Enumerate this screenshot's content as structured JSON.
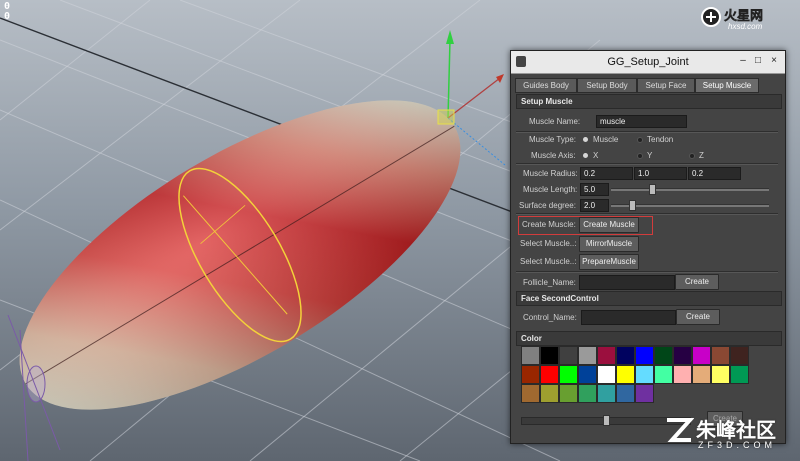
{
  "hud": {
    "line1": "0",
    "line2": "0"
  },
  "watermarks": {
    "top_right_domain": "hxsd.com",
    "bottom_right_cn": "朱峰社区",
    "bottom_right_url": "ZF3D.COM"
  },
  "window": {
    "title": "GG_Setup_Joint",
    "tabs": [
      "Guides Body",
      "Setup Body",
      "Setup Face",
      "Setup Muscle"
    ],
    "active_tab": "Setup Muscle",
    "setup_muscle": {
      "header": "Setup Muscle",
      "muscle_name_label": "Muscle Name:",
      "muscle_name_value": "muscle",
      "muscle_type_label": "Muscle Type:",
      "muscle_type_options": [
        "Muscle",
        "Tendon"
      ],
      "muscle_axis_label": "Muscle Axis:",
      "muscle_axis_options": [
        "X",
        "Y",
        "Z"
      ],
      "radius_label": "Muscle Radius:",
      "radius_values": [
        "0.2",
        "1.0",
        "0.2"
      ],
      "length_label": "Muscle Length:",
      "length_value": "5.0",
      "length_slider": 0.25,
      "surface_label": "Surface degree:",
      "surface_value": "2.0",
      "surface_slider": 0.12,
      "create_muscle_label": "Create Muscle:",
      "create_muscle_button": "Create Muscle",
      "select_muscle_label1": "Select Muscle..:",
      "mirror_button": "MirrorMuscle",
      "select_muscle_label2": "Select Muscle..:",
      "prepare_button": "PrepareMuscle",
      "follicle_label": "Follicle_Name:",
      "follicle_value": "",
      "follicle_create": "Create"
    },
    "face_second": {
      "header": "Face SecondControl",
      "control_label": "Control_Name:",
      "control_value": "",
      "create": "Create"
    },
    "color": {
      "header": "Color",
      "rows": [
        [
          "#808080",
          "#000000",
          "#404040",
          "#9a9a9a",
          "#9b0f3e",
          "#00025f",
          "#0000ff",
          "#004618",
          "#260043",
          "#c800c8",
          "#8a4833",
          "#3f231f"
        ],
        [
          "#992600",
          "#ff0000",
          "#00ff00",
          "#004199",
          "#ffffff",
          "#ffff00",
          "#64dcff",
          "#43ffa3",
          "#ffb0b0",
          "#e4ac79",
          "#ffff62",
          "#009954"
        ],
        [
          "#a06930",
          "#9e9f2f",
          "#689f30",
          "#30a05d",
          "#30a0a0",
          "#3067a0",
          "#6f30a0"
        ]
      ],
      "bottom_slider": 0.5,
      "bottom_button": "Create"
    }
  }
}
